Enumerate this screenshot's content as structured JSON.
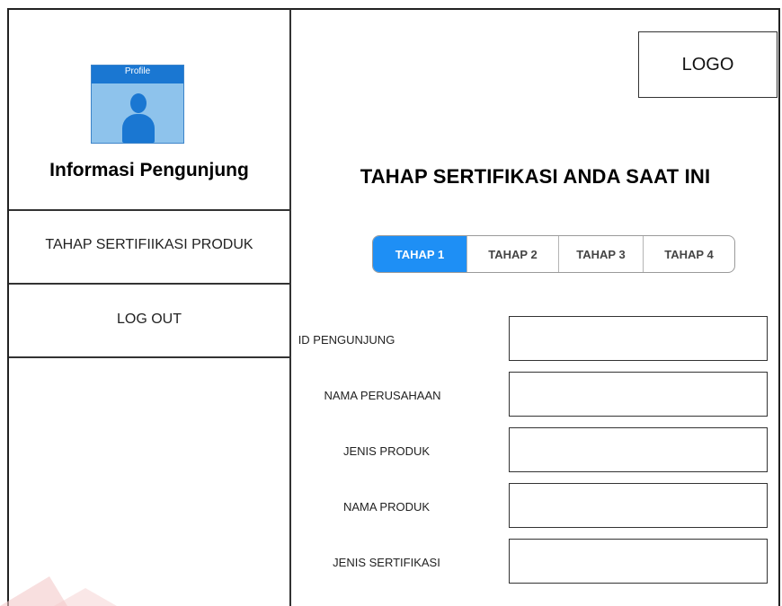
{
  "sidebar": {
    "profile_label": "Profile",
    "title": "Informasi Pengunjung",
    "items": [
      {
        "label": "TAHAP SERTIFIIKASI PRODUK"
      },
      {
        "label": "LOG OUT"
      }
    ]
  },
  "header": {
    "logo": "LOGO",
    "title": "TAHAP SERTIFIKASI ANDA SAAT INI"
  },
  "stepper": {
    "active_index": 0,
    "steps": [
      {
        "label": "TAHAP 1"
      },
      {
        "label": "TAHAP 2"
      },
      {
        "label": "TAHAP 3"
      },
      {
        "label": "TAHAP 4"
      }
    ]
  },
  "form": {
    "fields": [
      {
        "label": "ID PENGUNJUNG",
        "value": ""
      },
      {
        "label": "NAMA  PERUSAHAAN",
        "value": ""
      },
      {
        "label": "JENIS PRODUK",
        "value": ""
      },
      {
        "label": "NAMA PRODUK",
        "value": ""
      },
      {
        "label": "JENIS SERTIFIKASI",
        "value": ""
      }
    ]
  },
  "colors": {
    "accent": "#1e8ff5",
    "profile_bg": "#8ec3ec",
    "profile_dark": "#1a77d2"
  }
}
